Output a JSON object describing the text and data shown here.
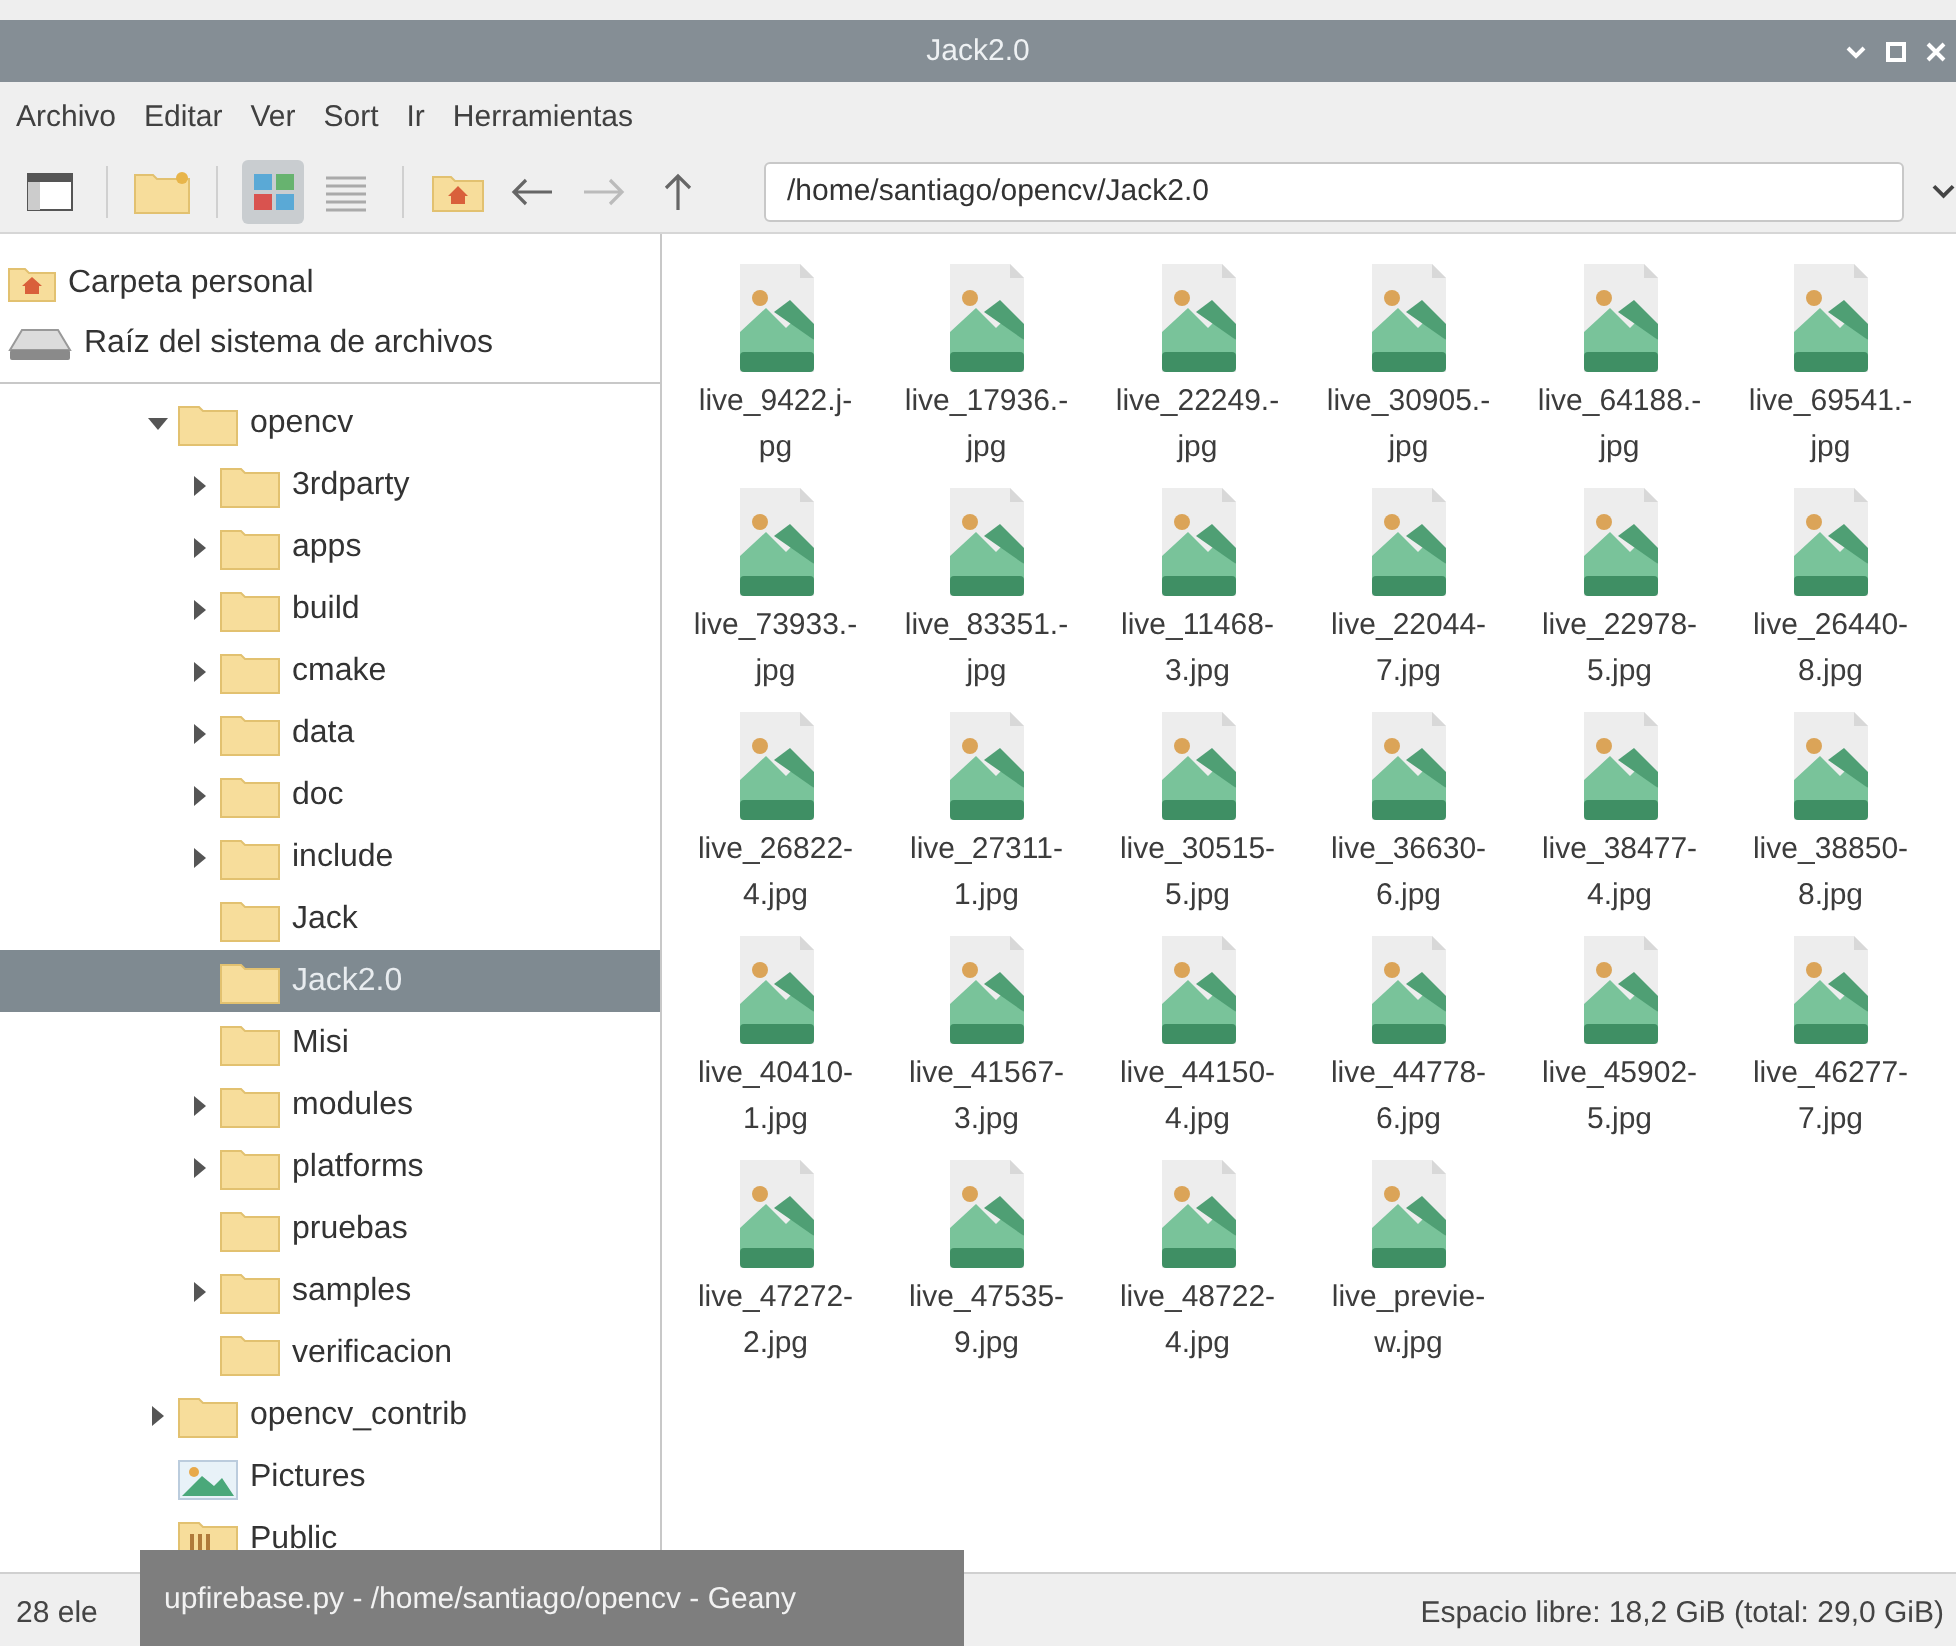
{
  "window": {
    "title": "Jack2.0"
  },
  "menu": [
    "Archivo",
    "Editar",
    "Ver",
    "Sort",
    "Ir",
    "Herramientas"
  ],
  "view_buttons": [
    {
      "kind": "icons",
      "selected": true
    },
    {
      "kind": "list",
      "selected": false
    }
  ],
  "location": {
    "value": "/home/santiago/opencv/Jack2.0"
  },
  "places": [
    {
      "label": "Carpeta personal",
      "kind": "home"
    },
    {
      "label": "Raíz del sistema de archivos",
      "kind": "drive"
    }
  ],
  "tree": [
    {
      "label": "opencv",
      "kind": "folder",
      "expandable": true,
      "expanded": true,
      "selected": false,
      "children": [
        {
          "label": "3rdparty",
          "kind": "folder",
          "expandable": true,
          "expanded": false,
          "selected": false
        },
        {
          "label": "apps",
          "kind": "folder",
          "expandable": true,
          "expanded": false,
          "selected": false
        },
        {
          "label": "build",
          "kind": "folder",
          "expandable": true,
          "expanded": false,
          "selected": false
        },
        {
          "label": "cmake",
          "kind": "folder",
          "expandable": true,
          "expanded": false,
          "selected": false
        },
        {
          "label": "data",
          "kind": "folder",
          "expandable": true,
          "expanded": false,
          "selected": false
        },
        {
          "label": "doc",
          "kind": "folder",
          "expandable": true,
          "expanded": false,
          "selected": false
        },
        {
          "label": "include",
          "kind": "folder",
          "expandable": true,
          "expanded": false,
          "selected": false
        },
        {
          "label": "Jack",
          "kind": "folder",
          "expandable": false,
          "selected": false
        },
        {
          "label": "Jack2.0",
          "kind": "folder",
          "expandable": false,
          "selected": true
        },
        {
          "label": "Misi",
          "kind": "folder",
          "expandable": false,
          "selected": false
        },
        {
          "label": "modules",
          "kind": "folder",
          "expandable": true,
          "expanded": false,
          "selected": false
        },
        {
          "label": "platforms",
          "kind": "folder",
          "expandable": true,
          "expanded": false,
          "selected": false
        },
        {
          "label": "pruebas",
          "kind": "folder",
          "expandable": false,
          "selected": false
        },
        {
          "label": "samples",
          "kind": "folder",
          "expandable": true,
          "expanded": false,
          "selected": false
        },
        {
          "label": "verificacion",
          "kind": "folder",
          "expandable": false,
          "selected": false
        }
      ]
    },
    {
      "label": "opencv_contrib",
      "kind": "folder",
      "expandable": true,
      "expanded": false,
      "selected": false
    },
    {
      "label": "Pictures",
      "kind": "pictures",
      "expandable": false,
      "selected": false
    },
    {
      "label": "Public",
      "kind": "public",
      "expandable": false,
      "selected": false
    }
  ],
  "files": [
    {
      "label": "live_9422.j-\npg"
    },
    {
      "label": "live_17936.-\njpg"
    },
    {
      "label": "live_22249.-\njpg"
    },
    {
      "label": "live_30905.-\njpg"
    },
    {
      "label": "live_64188.-\njpg"
    },
    {
      "label": "live_69541.-\njpg"
    },
    {
      "label": "live_73933.-\njpg"
    },
    {
      "label": "live_83351.-\njpg"
    },
    {
      "label": "live_11468-\n3.jpg"
    },
    {
      "label": "live_22044-\n7.jpg"
    },
    {
      "label": "live_22978-\n5.jpg"
    },
    {
      "label": "live_26440-\n8.jpg"
    },
    {
      "label": "live_26822-\n4.jpg"
    },
    {
      "label": "live_27311-\n1.jpg"
    },
    {
      "label": "live_30515-\n5.jpg"
    },
    {
      "label": "live_36630-\n6.jpg"
    },
    {
      "label": "live_38477-\n4.jpg"
    },
    {
      "label": "live_38850-\n8.jpg"
    },
    {
      "label": "live_40410-\n1.jpg"
    },
    {
      "label": "live_41567-\n3.jpg"
    },
    {
      "label": "live_44150-\n4.jpg"
    },
    {
      "label": "live_44778-\n6.jpg"
    },
    {
      "label": "live_45902-\n5.jpg"
    },
    {
      "label": "live_46277-\n7.jpg"
    },
    {
      "label": "live_47272-\n2.jpg"
    },
    {
      "label": "live_47535-\n9.jpg"
    },
    {
      "label": "live_48722-\n4.jpg"
    },
    {
      "label": "live_previe-\nw.jpg"
    }
  ],
  "status_bar": {
    "left": "28 ele",
    "right": "Espacio libre: 18,2 GiB (total: 29,0 GiB)"
  },
  "taskbar_tooltip": {
    "text": "upfirebase.py - /home/santiago/opencv - Geany"
  }
}
